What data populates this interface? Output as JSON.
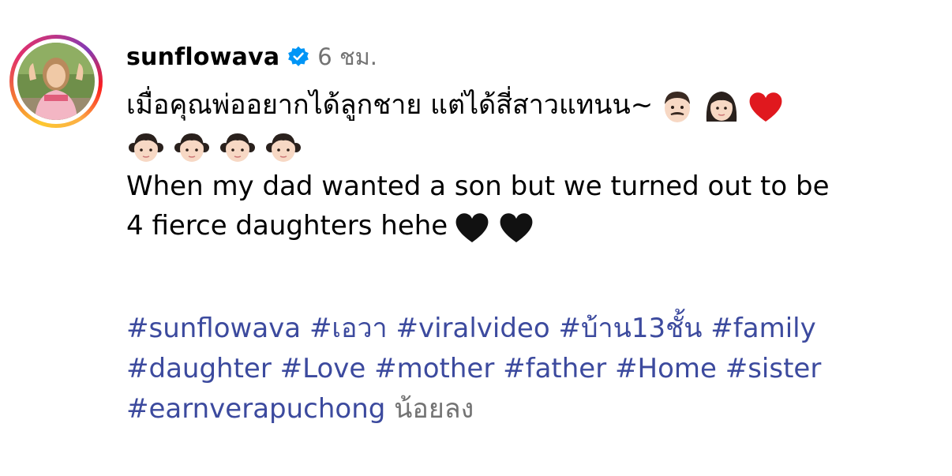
{
  "post": {
    "username": "sunflowava",
    "time": "6 ชม.",
    "verified_icon": "verified-badge-icon",
    "caption_th": "เมื่อคุณพ่ออยากได้ลูกชาย แต่ได้สี่สาวแทนน~",
    "caption_en_line1": "When my dad wanted a son but we turned out to be",
    "caption_en_line2": "4 fierce daughters hehe",
    "emojis_line1": [
      "man-emoji",
      "woman-emoji",
      "red-heart-emoji"
    ],
    "emojis_line2": [
      "girl-emoji",
      "girl-emoji",
      "girl-emoji",
      "girl-emoji"
    ],
    "emojis_line4": [
      "black-heart-emoji",
      "black-heart-emoji"
    ],
    "hashtags": [
      "#sunflowava",
      "#เอวา",
      "#viralvideo",
      "#บ้าน13ชั้น",
      "#family",
      "#daughter",
      "#Love",
      "#mother",
      "#father",
      "#Home",
      "#sister",
      "#earnverapuchong"
    ],
    "less_label": "น้อยลง"
  },
  "colors": {
    "hashtag": "#3c4a9e",
    "secondary_text": "#737373",
    "verified": "#0095f6"
  }
}
